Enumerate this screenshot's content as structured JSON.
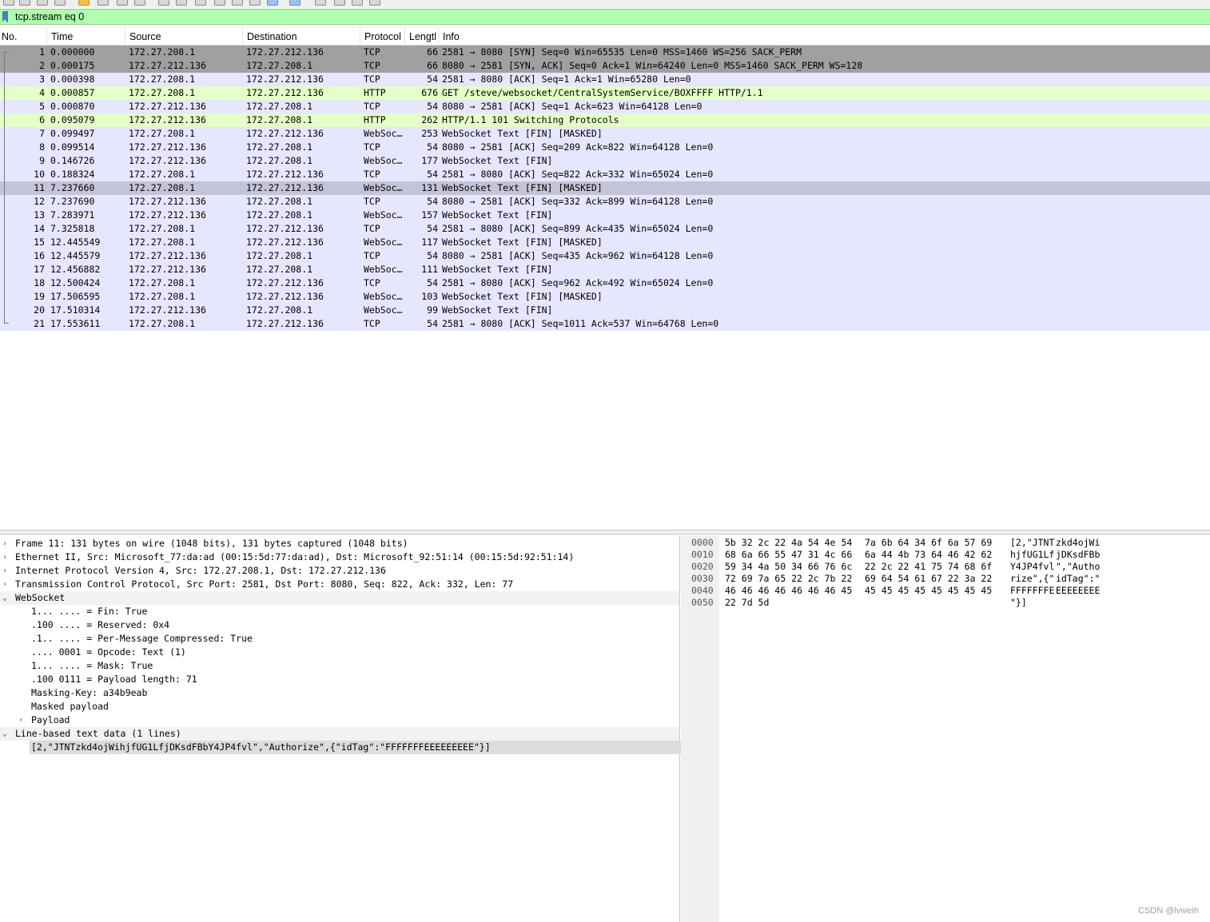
{
  "filter": {
    "value": "tcp.stream eq 0"
  },
  "columns": [
    "No.",
    "Time",
    "Source",
    "Destination",
    "Protocol",
    "Lengtl",
    "Info"
  ],
  "colors": {
    "tcp_syn_row": "#a0a0a0",
    "tcp_row": "#e7e6ff",
    "http_row": "#e4ffc7",
    "selected_row": "#c4c4d8",
    "filter_ok": "#afffaf"
  },
  "packets": [
    {
      "no": "1",
      "time": "0.000000",
      "src": "172.27.208.1",
      "dst": "172.27.212.136",
      "proto": "TCP",
      "len": "66",
      "info": "2581 → 8080 [SYN] Seq=0 Win=65535 Len=0 MSS=1460 WS=256 SACK_PERM",
      "kind": "syn"
    },
    {
      "no": "2",
      "time": "0.000175",
      "src": "172.27.212.136",
      "dst": "172.27.208.1",
      "proto": "TCP",
      "len": "66",
      "info": "8080 → 2581 [SYN, ACK] Seq=0 Ack=1 Win=64240 Len=0 MSS=1460 SACK_PERM WS=128",
      "kind": "syn"
    },
    {
      "no": "3",
      "time": "0.000398",
      "src": "172.27.208.1",
      "dst": "172.27.212.136",
      "proto": "TCP",
      "len": "54",
      "info": "2581 → 8080 [ACK] Seq=1 Ack=1 Win=65280 Len=0",
      "kind": "tcp"
    },
    {
      "no": "4",
      "time": "0.000857",
      "src": "172.27.208.1",
      "dst": "172.27.212.136",
      "proto": "HTTP",
      "len": "676",
      "info": "GET /steve/websocket/CentralSystemService/BOXFFFF HTTP/1.1",
      "kind": "http"
    },
    {
      "no": "5",
      "time": "0.000870",
      "src": "172.27.212.136",
      "dst": "172.27.208.1",
      "proto": "TCP",
      "len": "54",
      "info": "8080 → 2581 [ACK] Seq=1 Ack=623 Win=64128 Len=0",
      "kind": "tcp"
    },
    {
      "no": "6",
      "time": "0.095079",
      "src": "172.27.212.136",
      "dst": "172.27.208.1",
      "proto": "HTTP",
      "len": "262",
      "info": "HTTP/1.1 101 Switching Protocols",
      "kind": "http"
    },
    {
      "no": "7",
      "time": "0.099497",
      "src": "172.27.208.1",
      "dst": "172.27.212.136",
      "proto": "WebSoc…",
      "len": "253",
      "info": "WebSocket Text [FIN] [MASKED]",
      "kind": "tcp"
    },
    {
      "no": "8",
      "time": "0.099514",
      "src": "172.27.212.136",
      "dst": "172.27.208.1",
      "proto": "TCP",
      "len": "54",
      "info": "8080 → 2581 [ACK] Seq=209 Ack=822 Win=64128 Len=0",
      "kind": "tcp"
    },
    {
      "no": "9",
      "time": "0.146726",
      "src": "172.27.212.136",
      "dst": "172.27.208.1",
      "proto": "WebSoc…",
      "len": "177",
      "info": "WebSocket Text [FIN]",
      "kind": "tcp"
    },
    {
      "no": "10",
      "time": "0.188324",
      "src": "172.27.208.1",
      "dst": "172.27.212.136",
      "proto": "TCP",
      "len": "54",
      "info": "2581 → 8080 [ACK] Seq=822 Ack=332 Win=65024 Len=0",
      "kind": "tcp"
    },
    {
      "no": "11",
      "time": "7.237660",
      "src": "172.27.208.1",
      "dst": "172.27.212.136",
      "proto": "WebSoc…",
      "len": "131",
      "info": "WebSocket Text [FIN] [MASKED]",
      "kind": "selected"
    },
    {
      "no": "12",
      "time": "7.237690",
      "src": "172.27.212.136",
      "dst": "172.27.208.1",
      "proto": "TCP",
      "len": "54",
      "info": "8080 → 2581 [ACK] Seq=332 Ack=899 Win=64128 Len=0",
      "kind": "tcp"
    },
    {
      "no": "13",
      "time": "7.283971",
      "src": "172.27.212.136",
      "dst": "172.27.208.1",
      "proto": "WebSoc…",
      "len": "157",
      "info": "WebSocket Text [FIN]",
      "kind": "tcp"
    },
    {
      "no": "14",
      "time": "7.325818",
      "src": "172.27.208.1",
      "dst": "172.27.212.136",
      "proto": "TCP",
      "len": "54",
      "info": "2581 → 8080 [ACK] Seq=899 Ack=435 Win=65024 Len=0",
      "kind": "tcp"
    },
    {
      "no": "15",
      "time": "12.445549",
      "src": "172.27.208.1",
      "dst": "172.27.212.136",
      "proto": "WebSoc…",
      "len": "117",
      "info": "WebSocket Text [FIN] [MASKED]",
      "kind": "tcp"
    },
    {
      "no": "16",
      "time": "12.445579",
      "src": "172.27.212.136",
      "dst": "172.27.208.1",
      "proto": "TCP",
      "len": "54",
      "info": "8080 → 2581 [ACK] Seq=435 Ack=962 Win=64128 Len=0",
      "kind": "tcp"
    },
    {
      "no": "17",
      "time": "12.456882",
      "src": "172.27.212.136",
      "dst": "172.27.208.1",
      "proto": "WebSoc…",
      "len": "111",
      "info": "WebSocket Text [FIN]",
      "kind": "tcp"
    },
    {
      "no": "18",
      "time": "12.500424",
      "src": "172.27.208.1",
      "dst": "172.27.212.136",
      "proto": "TCP",
      "len": "54",
      "info": "2581 → 8080 [ACK] Seq=962 Ack=492 Win=65024 Len=0",
      "kind": "tcp"
    },
    {
      "no": "19",
      "time": "17.506595",
      "src": "172.27.208.1",
      "dst": "172.27.212.136",
      "proto": "WebSoc…",
      "len": "103",
      "info": "WebSocket Text [FIN] [MASKED]",
      "kind": "tcp"
    },
    {
      "no": "20",
      "time": "17.510314",
      "src": "172.27.212.136",
      "dst": "172.27.208.1",
      "proto": "WebSoc…",
      "len": "99",
      "info": "WebSocket Text [FIN]",
      "kind": "tcp"
    },
    {
      "no": "21",
      "time": "17.553611",
      "src": "172.27.208.1",
      "dst": "172.27.212.136",
      "proto": "TCP",
      "len": "54",
      "info": "2581 → 8080 [ACK] Seq=1011 Ack=537 Win=64768 Len=0",
      "kind": "tcp"
    }
  ],
  "details": [
    {
      "text": "Frame 11: 131 bytes on wire (1048 bits), 131 bytes captured (1048 bits)",
      "arrow": "›",
      "indent": 0
    },
    {
      "text": "Ethernet II, Src: Microsoft_77:da:ad (00:15:5d:77:da:ad), Dst: Microsoft_92:51:14 (00:15:5d:92:51:14)",
      "arrow": "›",
      "indent": 0
    },
    {
      "text": "Internet Protocol Version 4, Src: 172.27.208.1, Dst: 172.27.212.136",
      "arrow": "›",
      "indent": 0
    },
    {
      "text": "Transmission Control Protocol, Src Port: 2581, Dst Port: 8080, Seq: 822, Ack: 332, Len: 77",
      "arrow": "›",
      "indent": 0
    },
    {
      "text": "WebSocket",
      "arrow": "⌄",
      "indent": 0,
      "hl": true
    },
    {
      "text": "1... .... = Fin: True",
      "arrow": "",
      "indent": 1
    },
    {
      "text": ".100 .... = Reserved: 0x4",
      "arrow": "",
      "indent": 1
    },
    {
      "text": ".1.. .... = Per-Message Compressed: True",
      "arrow": "",
      "indent": 1
    },
    {
      "text": ".... 0001 = Opcode: Text (1)",
      "arrow": "",
      "indent": 1
    },
    {
      "text": "1... .... = Mask: True",
      "arrow": "",
      "indent": 1
    },
    {
      "text": ".100 0111 = Payload length: 71",
      "arrow": "",
      "indent": 1
    },
    {
      "text": "Masking-Key: a34b9eab",
      "arrow": "",
      "indent": 1
    },
    {
      "text": "Masked payload",
      "arrow": "",
      "indent": 1
    },
    {
      "text": "Payload",
      "arrow": "›",
      "indent": 1
    },
    {
      "text": "Line-based text data (1 lines)",
      "arrow": "⌄",
      "indent": 0,
      "hl": true
    },
    {
      "text": "[2,\"JTNTzkd4ojWihjfUG1LfjDKsdFBbY4JP4fvl\",\"Authorize\",{\"idTag\":\"FFFFFFFEEEEEEEEE\"}]",
      "arrow": "",
      "indent": 1,
      "selected": true
    }
  ],
  "bytes": [
    {
      "offset": "0000",
      "hex1": "5b 32 2c 22 4a 54 4e 54",
      "hex2": "7a 6b 64 34 6f 6a 57 69",
      "ascii1": "[2,\"JTNT",
      "ascii2": "zkd4ojWi"
    },
    {
      "offset": "0010",
      "hex1": "68 6a 66 55 47 31 4c 66",
      "hex2": "6a 44 4b 73 64 46 42 62",
      "ascii1": "hjfUG1Lf",
      "ascii2": "jDKsdFBb"
    },
    {
      "offset": "0020",
      "hex1": "59 34 4a 50 34 66 76 6c",
      "hex2": "22 2c 22 41 75 74 68 6f",
      "ascii1": "Y4JP4fvl",
      "ascii2": "\",\"Autho"
    },
    {
      "offset": "0030",
      "hex1": "72 69 7a 65 22 2c 7b 22",
      "hex2": "69 64 54 61 67 22 3a 22",
      "ascii1": "rize\",{\"",
      "ascii2": "idTag\":\""
    },
    {
      "offset": "0040",
      "hex1": "46 46 46 46 46 46 46 45",
      "hex2": "45 45 45 45 45 45 45 45",
      "ascii1": "FFFFFFFE",
      "ascii2": "EEEEEEEE"
    },
    {
      "offset": "0050",
      "hex1": "22 7d 5d",
      "hex2": "",
      "ascii1": "\"}]",
      "ascii2": ""
    }
  ],
  "watermark": "CSDN @lvweih"
}
